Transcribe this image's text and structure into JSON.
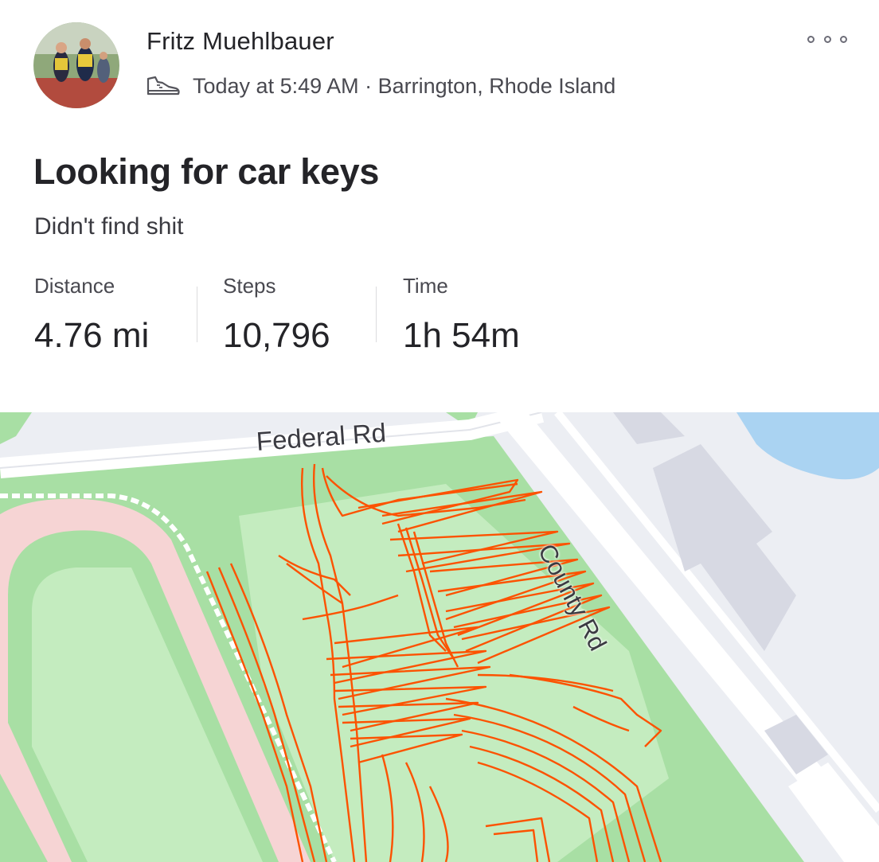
{
  "post": {
    "athlete_name": "Fritz Muehlbauer",
    "meta": "Today at 5:49 AM · Barrington, Rhode Island",
    "activity_icon": "shoe-icon",
    "more_icon": "more-options-icon"
  },
  "activity": {
    "title": "Looking for car keys",
    "description": "Didn't find shit"
  },
  "stats": [
    {
      "label": "Distance",
      "value": "4.76 mi"
    },
    {
      "label": "Steps",
      "value": "10,796"
    },
    {
      "label": "Time",
      "value": "1h 54m"
    }
  ],
  "map": {
    "roads": [
      {
        "label": "Federal Rd"
      },
      {
        "label": "County Rd"
      }
    ],
    "route_color": "#fc5200",
    "park_color": "#a8dfa4",
    "track_color": "#f6d4d4",
    "water_color": "#aad3f2"
  }
}
